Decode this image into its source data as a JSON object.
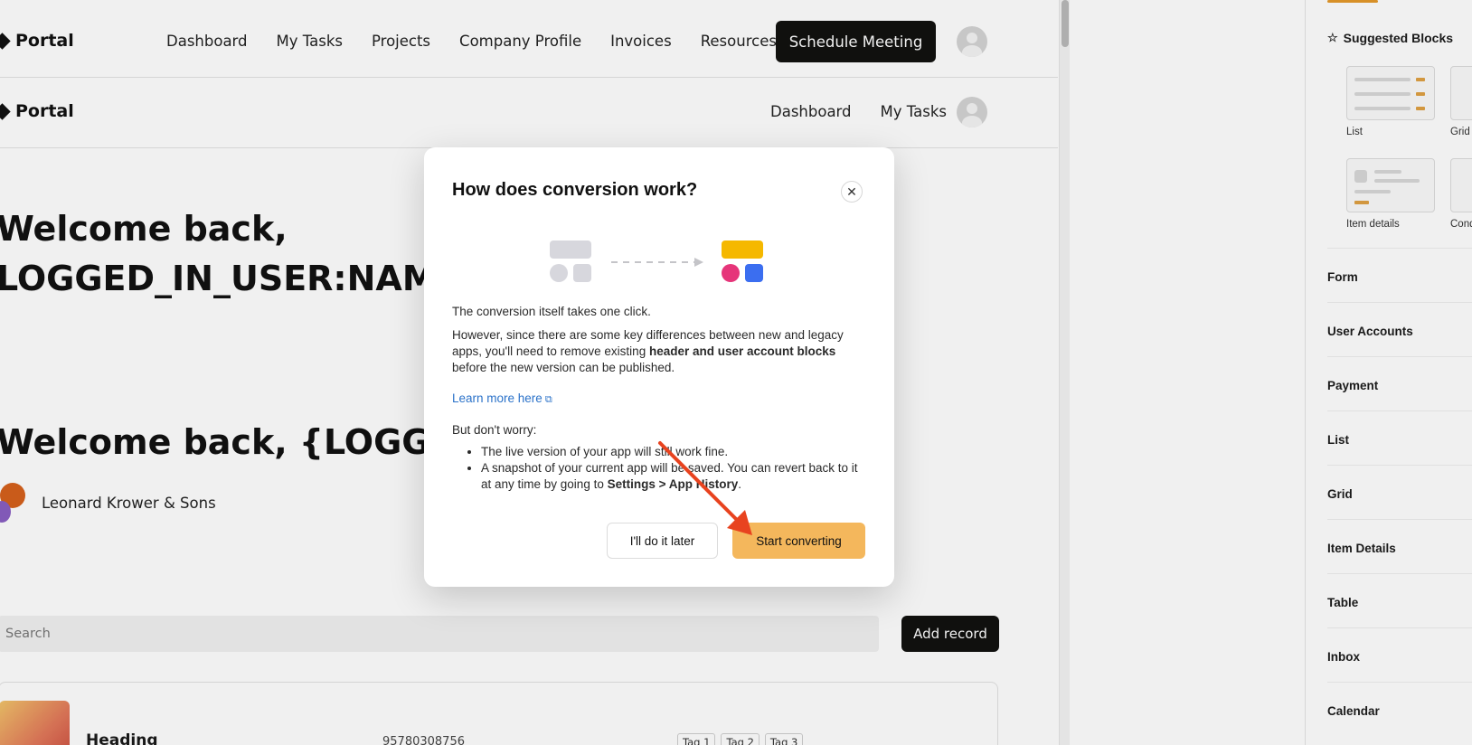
{
  "app": {
    "logo_text": "Portal",
    "nav_primary": [
      "Dashboard",
      "My Tasks",
      "Projects",
      "Company Profile",
      "Invoices",
      "Resources"
    ],
    "schedule_label": "Schedule Meeting",
    "nav_secondary": [
      "Dashboard",
      "My Tasks"
    ],
    "welcome_heading_1": "Welcome back,",
    "welcome_heading_1b": "LOGGED_IN_USER:NAME}!",
    "welcome_heading_2": "Welcome back, {LOGGED_IN",
    "company_name": "Leonard Krower & Sons",
    "search_placeholder": "Search",
    "add_record_label": "Add record",
    "card": {
      "heading": "Heading",
      "number": "95780308756",
      "tags": [
        "Tag 1",
        "Tag 2",
        "Tag 3"
      ]
    }
  },
  "panel": {
    "suggested_title": "Suggested Blocks",
    "blocks": [
      "List",
      "Grid",
      "Item details",
      "Cond"
    ],
    "items": [
      "Form",
      "User Accounts",
      "Payment",
      "List",
      "Grid",
      "Item Details",
      "Table",
      "Inbox",
      "Calendar"
    ]
  },
  "modal": {
    "title": "How does conversion work?",
    "intro": "The conversion itself takes one click.",
    "para_before_bold": "However, since there are some key differences between new and legacy apps, you'll need to remove existing ",
    "para_bold": "header and user account blocks",
    "para_after_bold": " before the new version can be published.",
    "learn_more": "Learn more here",
    "dont_worry": "But don't worry:",
    "bullet_1": "The live version of your app will still work fine.",
    "bullet_2_before": "A snapshot of your current app will be saved. You can revert back to it at any time by going to ",
    "bullet_2_bold": "Settings > App History",
    "bullet_2_after": ".",
    "later_label": "I'll do it later",
    "start_label": "Start converting"
  },
  "colors": {
    "accent_orange": "#f4b75c",
    "link_blue": "#2b72c9",
    "annotation_arrow": "#e8431f",
    "illus_yellow": "#f5b800",
    "illus_pink": "#e6357a",
    "illus_blue": "#3b6ef0"
  },
  "icons": [
    "close-icon",
    "external-link-icon",
    "star-icon",
    "avatar-icon"
  ]
}
